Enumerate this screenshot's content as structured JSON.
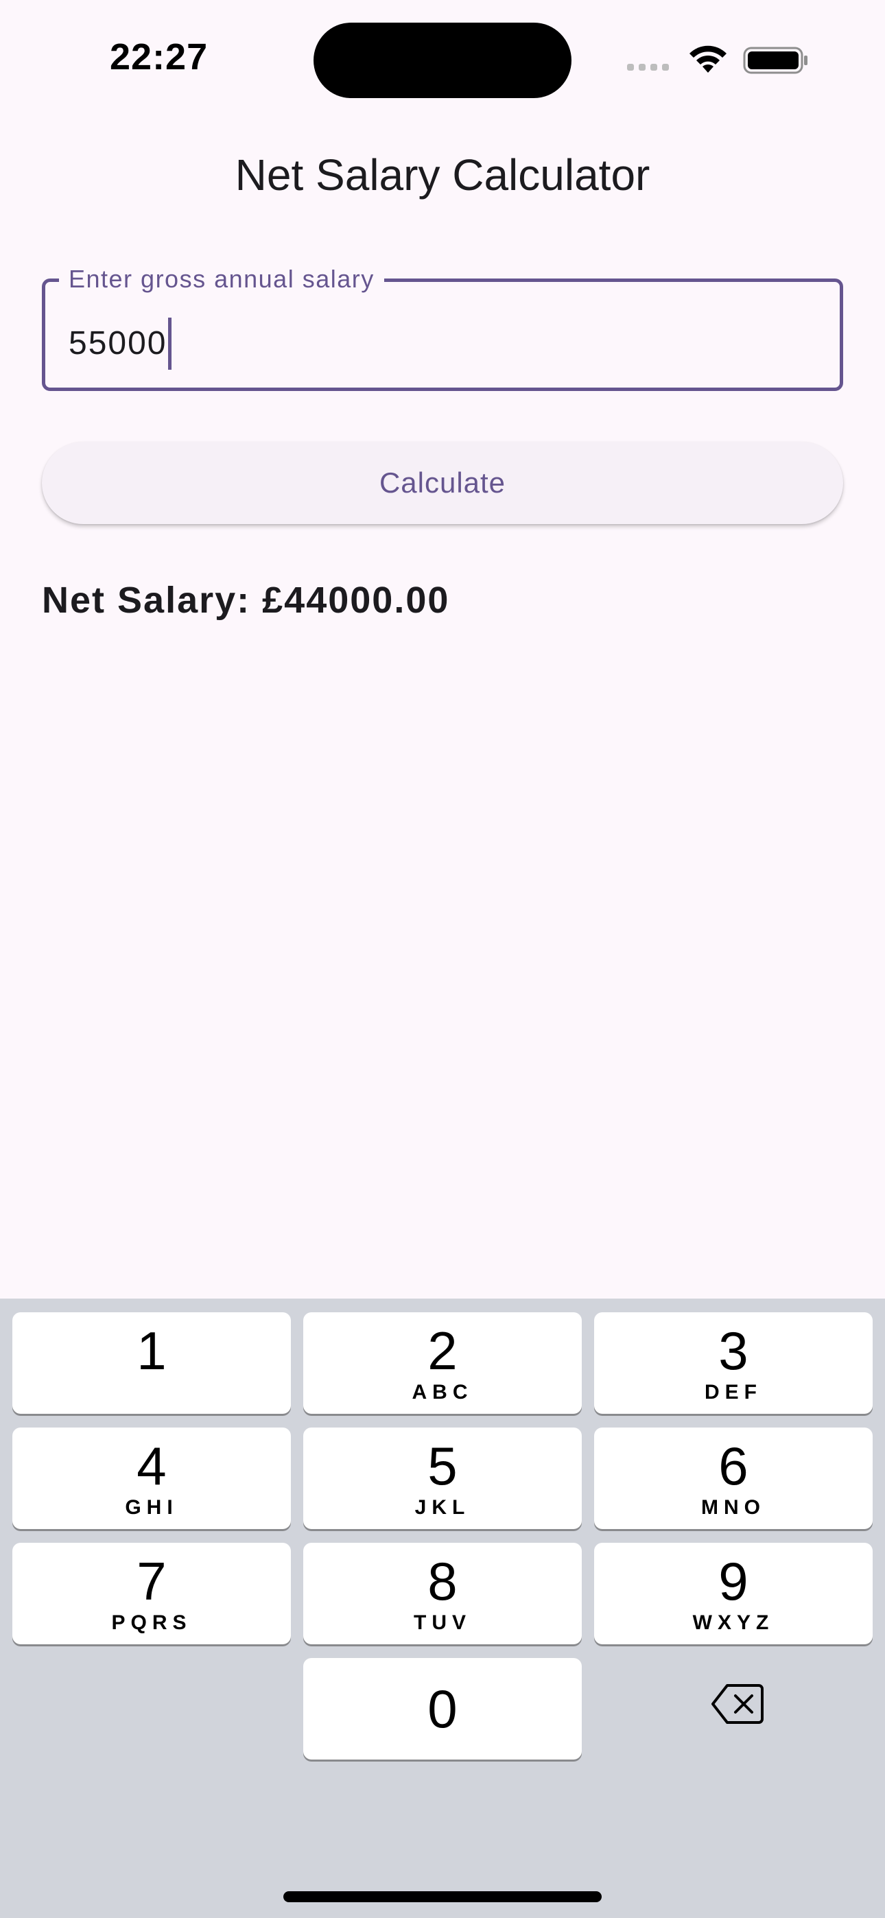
{
  "status_bar": {
    "time": "22:27"
  },
  "app": {
    "title": "Net Salary Calculator",
    "input": {
      "label": "Enter gross annual salary",
      "value": "55000"
    },
    "calculate_label": "Calculate",
    "result_text": "Net Salary: £44000.00"
  },
  "keyboard": {
    "keys": [
      {
        "digit": "1",
        "letters": ""
      },
      {
        "digit": "2",
        "letters": "ABC"
      },
      {
        "digit": "3",
        "letters": "DEF"
      },
      {
        "digit": "4",
        "letters": "GHI"
      },
      {
        "digit": "5",
        "letters": "JKL"
      },
      {
        "digit": "6",
        "letters": "MNO"
      },
      {
        "digit": "7",
        "letters": "PQRS"
      },
      {
        "digit": "8",
        "letters": "TUV"
      },
      {
        "digit": "9",
        "letters": "WXYZ"
      },
      {
        "digit": "0",
        "letters": ""
      }
    ],
    "delete_icon": "delete-backspace-icon"
  },
  "colors": {
    "accent": "#65558f",
    "background": "#fdf7fc",
    "keyboard_background": "#d1d4db"
  }
}
